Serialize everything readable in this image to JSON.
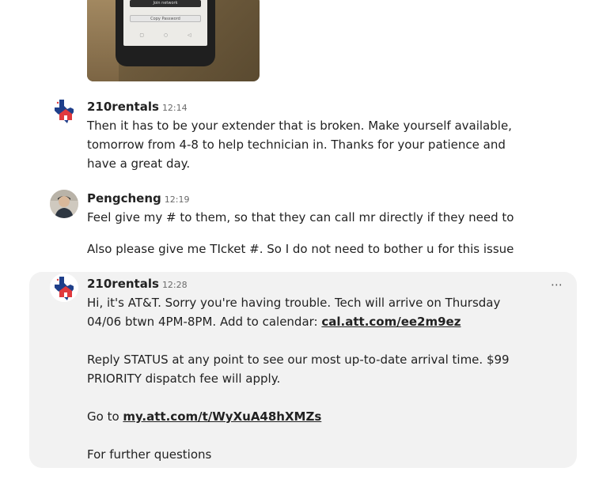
{
  "attachment": {
    "phone_button_1": "Join network",
    "phone_button_2": "Copy Password"
  },
  "messages": [
    {
      "sender": "210rentals",
      "time": "12:14",
      "paragraphs": [
        "Then it has to be your extender that is broken. Make yourself available, tomorrow from 4-8 to help technician in. Thanks for your patience and have a great day."
      ]
    },
    {
      "sender": "Pengcheng",
      "time": "12:19",
      "paragraphs": [
        "Feel give my # to them, so that they can call mr directly if they need to",
        "Also please give me TIcket #. So I do not need to bother u for this issue"
      ]
    },
    {
      "sender": "210rentals",
      "time": "12:28",
      "p1_text": "Hi, it's AT&T. Sorry you're having trouble. Tech will arrive on Thursday 04/06 btwn 4PM-8PM. Add to calendar: ",
      "p1_link": "cal.att.com/ee2m9ez",
      "p2_text": "Reply STATUS at any point to see our most up-to-date arrival time. $99 PRIORITY dispatch fee will apply.",
      "p3_text": "Go to ",
      "p3_link": "my.att.com/t/WyXuA48hXMZs",
      "p4_text": "For further questions"
    }
  ],
  "more_icon": "⋯",
  "colors": {
    "highlight_bg": "#f2f2f2",
    "logo_blue": "#1f3f8a",
    "logo_red": "#e03a3e"
  }
}
